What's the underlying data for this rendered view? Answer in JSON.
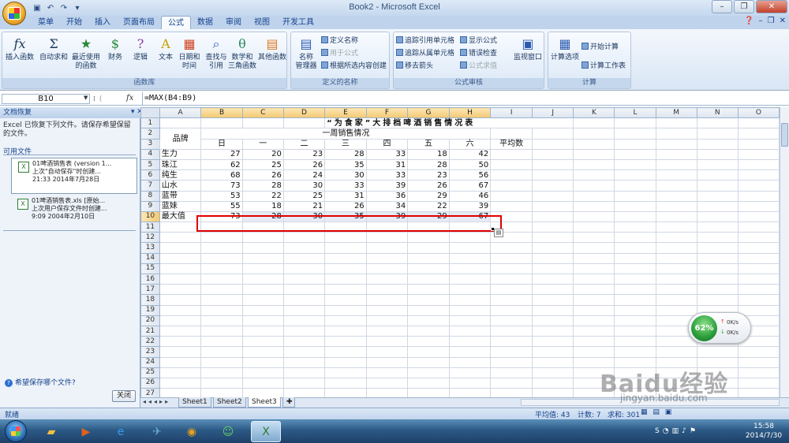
{
  "window": {
    "title": "Book2 - Microsoft Excel",
    "qat_icons": [
      "save-icon",
      "undo-icon",
      "redo-icon",
      "customize-icon"
    ],
    "controls": {
      "minimize": "–",
      "restore": "❐",
      "close": "✕"
    }
  },
  "ribbon_tabs": [
    "菜单",
    "开始",
    "插入",
    "页面布局",
    "公式",
    "数据",
    "审阅",
    "视图",
    "开发工具"
  ],
  "active_tab": "公式",
  "ribbon": {
    "function_library": {
      "label": "函数库",
      "insert_fn": "插入函数",
      "autosum": "自动求和",
      "recent_1": "最近使用",
      "recent_2": "的函数",
      "financial": "财务",
      "logical": "逻辑",
      "text": "文本",
      "datetime_1": "日期和",
      "datetime_2": "时间",
      "lookup_1": "查找与",
      "lookup_2": "引用",
      "math_1": "数学和",
      "math_2": "三角函数",
      "more": "其他函数"
    },
    "defined_names": {
      "label": "定义的名称",
      "name_manager_1": "名称",
      "name_manager_2": "管理器",
      "define_name": "定义名称",
      "use_in_formula": "用于公式",
      "create_from_sel": "根据所选内容创建"
    },
    "formula_auditing": {
      "label": "公式审核",
      "trace_precedents": "追踪引用单元格",
      "trace_dependents": "追踪从属单元格",
      "remove_arrows": "移去箭头",
      "show_formulas": "显示公式",
      "error_checking": "错误检查",
      "evaluate_formula": "公式求值",
      "watch_window": "监视窗口"
    },
    "calculation": {
      "label": "计算",
      "calc_options": "计算选项",
      "calc_now": "开始计算",
      "calc_sheet": "计算工作表"
    }
  },
  "formula_bar": {
    "name_box": "B10",
    "fx": "fx",
    "formula": "=MAX(B4:B9)"
  },
  "recovery_pane": {
    "title": "文档恢复",
    "description": "Excel 已恢复下列文件。请保存希望保留的文件。",
    "available_label": "可用文件",
    "files": [
      {
        "name": "01啤酒销售表 (version 1...",
        "line2": "上次\"自动保存\"时创建...",
        "line3": "21:33 2014年7月28日"
      },
      {
        "name": "01啤酒销售表.xls [原始...",
        "line2": "上次用户保存文件时创建...",
        "line3": "9:09 2004年2月10日"
      }
    ],
    "help_link": "希望保存哪个文件?",
    "close_button": "关闭"
  },
  "sheet": {
    "columns": [
      "A",
      "B",
      "C",
      "D",
      "E",
      "F",
      "G",
      "H",
      "I",
      "J",
      "K",
      "L",
      "M",
      "N",
      "O"
    ],
    "row_numbers": [
      "1",
      "2",
      "3",
      "4",
      "5",
      "6",
      "7",
      "8",
      "9",
      "10",
      "11",
      "12",
      "13",
      "14",
      "15",
      "16",
      "17",
      "18",
      "19",
      "20",
      "21",
      "22",
      "23",
      "24",
      "25",
      "26",
      "27"
    ],
    "title": "“为食家”大排档啤酒销售情况表",
    "week_header": "一周销售情况",
    "brand_header": "品牌",
    "avg_header": "平均数",
    "days": [
      "日",
      "一",
      "二",
      "三",
      "四",
      "五",
      "六"
    ],
    "brands": [
      "生力",
      "珠江",
      "纯生",
      "山水",
      "蓝带",
      "蓝妹"
    ],
    "values": [
      [
        27,
        20,
        23,
        28,
        33,
        18,
        42
      ],
      [
        62,
        25,
        26,
        35,
        31,
        28,
        50
      ],
      [
        68,
        26,
        24,
        30,
        33,
        23,
        56
      ],
      [
        73,
        28,
        30,
        33,
        39,
        26,
        67
      ],
      [
        53,
        22,
        25,
        31,
        36,
        29,
        46
      ],
      [
        55,
        18,
        21,
        26,
        34,
        22,
        39
      ]
    ],
    "max_label": "最大值",
    "max_values": [
      73,
      28,
      30,
      35,
      39,
      29,
      67
    ],
    "selected_cell": "B10"
  },
  "sheet_tabs": [
    "Sheet1",
    "Sheet2",
    "Sheet3"
  ],
  "active_sheet": "Sheet3",
  "status_bar": {
    "ready": "就绪",
    "average": "平均值: 43",
    "count": "计数: 7",
    "sum": "求和: 301"
  },
  "speed_widget": {
    "percent": "62%",
    "up": "0K/s",
    "down": "0K/s"
  },
  "clock": {
    "time": "15:58",
    "date": "2014/7/30"
  },
  "watermark": {
    "text": "Baidu经验",
    "sub": "jingyan.baidu.com"
  }
}
